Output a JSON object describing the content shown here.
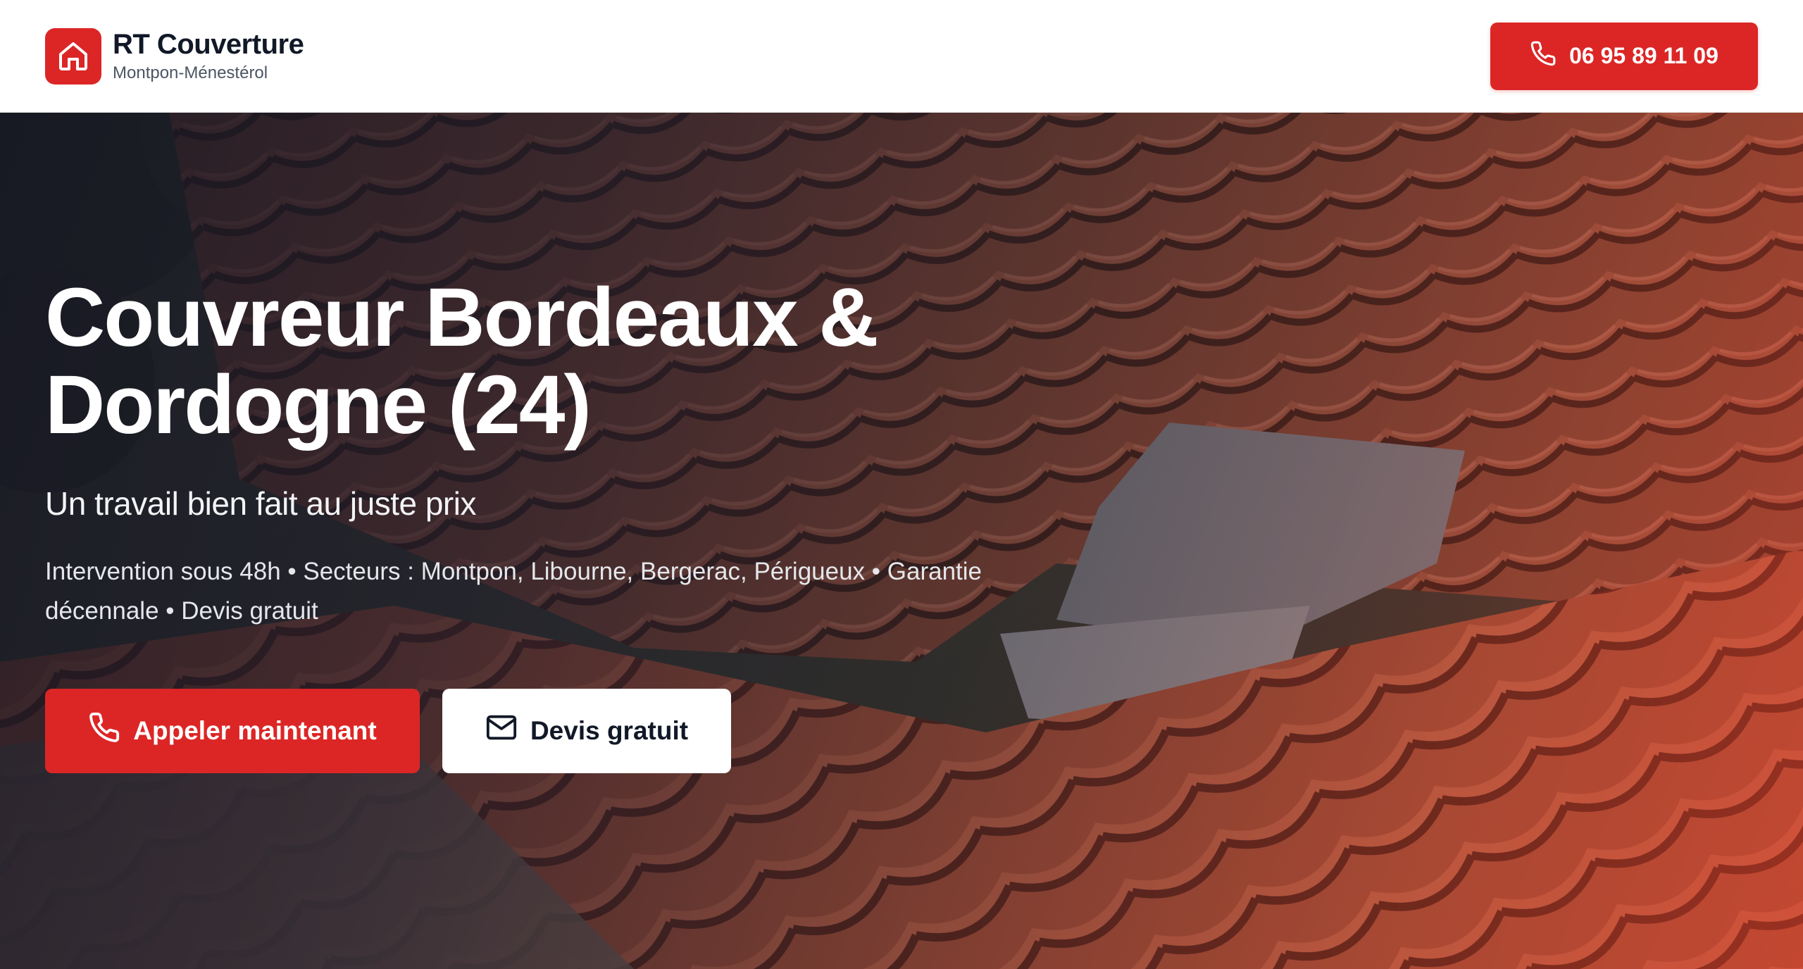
{
  "header": {
    "brand_name": "RT Couverture",
    "brand_location": "Montpon-Ménestérol",
    "logo_icon": "house-icon",
    "phone_icon": "phone-icon",
    "phone_label": "06 95 89 11 09"
  },
  "hero": {
    "title_line1": "Couvreur Bordeaux &",
    "title_line2": "Dordogne (24)",
    "subtitle": "Un travail bien fait au juste prix",
    "info": "Intervention sous 48h • Secteurs : Montpon, Libourne, Bergerac, Périgueux • Garantie décennale • Devis gratuit",
    "primary_button": {
      "label": "Appeler maintenant",
      "icon": "phone-icon"
    },
    "secondary_button": {
      "label": "Devis gratuit",
      "icon": "mail-icon"
    }
  },
  "colors": {
    "accent": "#dc2626",
    "header_bg": "#ffffff",
    "text_dark": "#111827",
    "text_muted": "#4b5563"
  }
}
